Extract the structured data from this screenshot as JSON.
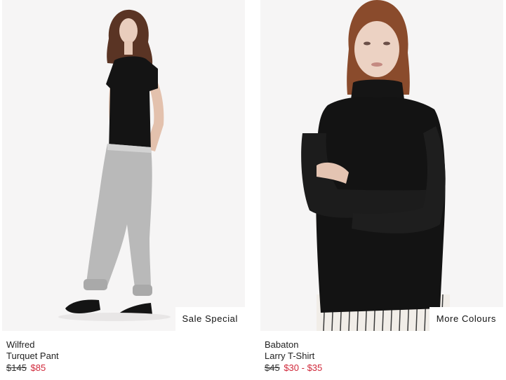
{
  "products": [
    {
      "brand": "Wilfred",
      "name": "Turquet Pant",
      "original_price": "$145",
      "sale_price": "$85",
      "badge": "Sale Special"
    },
    {
      "brand": "Babaton",
      "name": "Larry T-Shirt",
      "original_price": "$45",
      "sale_price": "$30 - $35",
      "badge": "More Colours"
    }
  ],
  "colors": {
    "sale_price": "#d0283a",
    "photo_background": "#f6f5f5"
  }
}
